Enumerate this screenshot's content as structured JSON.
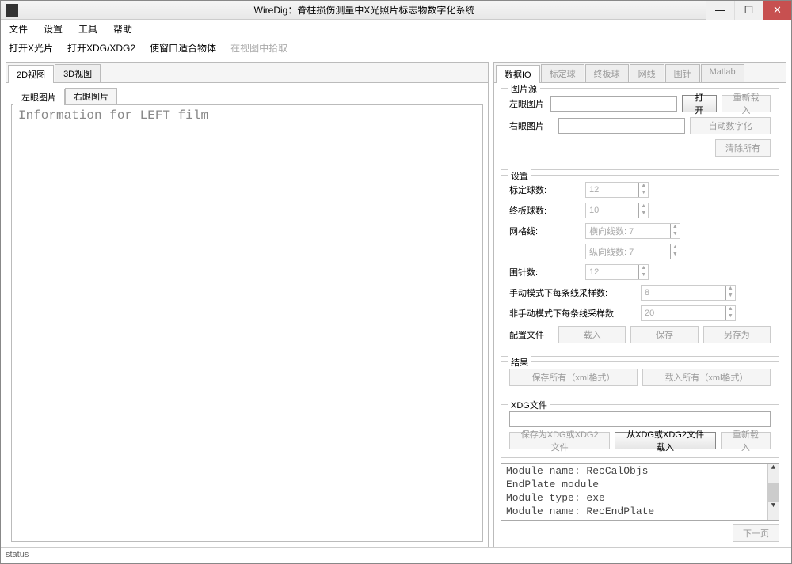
{
  "window": {
    "title": "WireDig：脊柱损伤测量中X光照片标志物数字化系统",
    "min": "—",
    "max": "☐",
    "close": "✕"
  },
  "menubar": [
    "文件",
    "设置",
    "工具",
    "帮助"
  ],
  "toolbar": {
    "open_xray": "打开X光片",
    "open_xdg": "打开XDG/XDG2",
    "fit_window": "使窗口适合物体",
    "pick_in_view": "在视图中拾取"
  },
  "left_tabs": {
    "tab2d": "2D视图",
    "tab3d": "3D视图",
    "sub_left": "左眼图片",
    "sub_right": "右眼图片",
    "info_text": "Information for LEFT film"
  },
  "right_tabs": [
    "数据IO",
    "标定球",
    "终板球",
    "网线",
    "围针",
    "Matlab"
  ],
  "image_src": {
    "group": "图片源",
    "left_label": "左眼图片",
    "right_label": "右眼图片",
    "open": "打开",
    "reload": "重新载入",
    "auto_digit": "自动数字化",
    "clear_all": "清除所有"
  },
  "settings": {
    "group": "设置",
    "calib_balls": "标定球数:",
    "calib_val": "12",
    "endplate_balls": "终板球数:",
    "endplate_val": "10",
    "grid_lines": "网格线:",
    "hgrid": "横向线数: 7",
    "vgrid": "纵向线数: 7",
    "wire_pins": "围针数:",
    "wire_val": "12",
    "manual_samples": "手动模式下每条线采样数:",
    "manual_val": "8",
    "nonmanual_samples": "非手动模式下每条线采样数:",
    "nonmanual_val": "20",
    "config_file": "配置文件",
    "load": "载入",
    "save": "保存",
    "save_as": "另存为"
  },
  "results": {
    "group": "结果",
    "save_all": "保存所有（xml格式）",
    "load_all": "载入所有（xml格式）"
  },
  "xdg": {
    "group": "XDG文件",
    "save_xdg": "保存为XDG或XDG2文件",
    "load_xdg": "从XDG或XDG2文件载入",
    "reload": "重新载入"
  },
  "output_lines": [
    "Module name: RecCalObjs",
    "EndPlate module",
    "Module type: exe",
    "Module name: RecEndPlate"
  ],
  "next_page": "下一页",
  "status": "status"
}
